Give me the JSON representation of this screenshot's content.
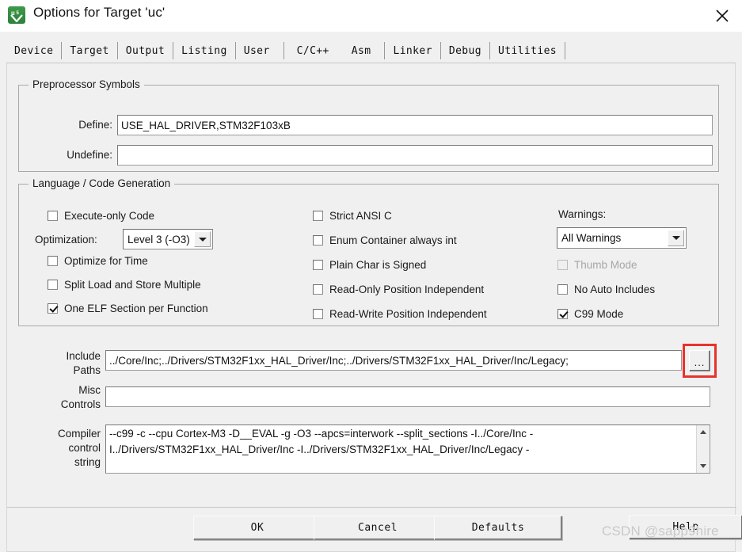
{
  "window": {
    "title": "Options for Target 'uc'",
    "icon": "keil-uvision5-icon",
    "close_label": "✕"
  },
  "tabs": [
    {
      "label": "Device",
      "active": false
    },
    {
      "label": "Target",
      "active": false
    },
    {
      "label": "Output",
      "active": false
    },
    {
      "label": "Listing",
      "active": false
    },
    {
      "label": "User",
      "active": false
    },
    {
      "label": "C/C++",
      "active": true
    },
    {
      "label": "Asm",
      "active": false
    },
    {
      "label": "Linker",
      "active": false
    },
    {
      "label": "Debug",
      "active": false
    },
    {
      "label": "Utilities",
      "active": false
    }
  ],
  "preprocessor": {
    "group_title": "Preprocessor Symbols",
    "define_label": "Define:",
    "define_value": "USE_HAL_DRIVER,STM32F103xB",
    "undefine_label": "Undefine:",
    "undefine_value": ""
  },
  "language": {
    "group_title": "Language / Code Generation",
    "execute_only_code": {
      "label": "Execute-only Code",
      "checked": false,
      "disabled": false
    },
    "optimization_label": "Optimization:",
    "optimization_value": "Level 3 (-O3)",
    "optimize_for_time": {
      "label": "Optimize for Time",
      "checked": false,
      "disabled": false
    },
    "split_load_store": {
      "label": "Split Load and Store Multiple",
      "checked": false,
      "disabled": false
    },
    "one_elf_section": {
      "label": "One ELF Section per Function",
      "checked": true,
      "disabled": false
    },
    "strict_ansi_c": {
      "label": "Strict ANSI C",
      "checked": false,
      "disabled": false
    },
    "enum_container_int": {
      "label": "Enum Container always int",
      "checked": false,
      "disabled": false
    },
    "plain_char_signed": {
      "label": "Plain Char is Signed",
      "checked": false,
      "disabled": false
    },
    "read_only_pos_ind": {
      "label": "Read-Only Position Independent",
      "checked": false,
      "disabled": false
    },
    "read_write_pos_ind": {
      "label": "Read-Write Position Independent",
      "checked": false,
      "disabled": false
    },
    "warnings_label": "Warnings:",
    "warnings_value": "All Warnings",
    "thumb_mode": {
      "label": "Thumb Mode",
      "checked": false,
      "disabled": true
    },
    "no_auto_includes": {
      "label": "No Auto Includes",
      "checked": false,
      "disabled": false
    },
    "c99_mode": {
      "label": "C99 Mode",
      "checked": true,
      "disabled": false
    }
  },
  "paths": {
    "include_label_line1": "Include",
    "include_label_line2": "Paths",
    "include_value": "../Core/Inc;../Drivers/STM32F1xx_HAL_Driver/Inc;../Drivers/STM32F1xx_HAL_Driver/Inc/Legacy;",
    "browse_label": "...",
    "misc_label_line1": "Misc",
    "misc_label_line2": "Controls",
    "misc_value": ""
  },
  "compiler": {
    "label_line1": "Compiler",
    "label_line2": "control",
    "label_line3": "string",
    "lines": [
      "--c99 -c --cpu Cortex-M3 -D__EVAL -g -O3 --apcs=interwork --split_sections -I../Core/Inc -",
      "I../Drivers/STM32F1xx_HAL_Driver/Inc -I../Drivers/STM32F1xx_HAL_Driver/Inc/Legacy -"
    ],
    "scroll_up": "▲",
    "scroll_down": "▼"
  },
  "footer": {
    "ok": "OK",
    "cancel": "Cancel",
    "defaults": "Defaults",
    "help": "Help"
  },
  "watermark": "CSDN @sapp9hire",
  "colors": {
    "dialog_bg": "#f0f0f0",
    "accent_highlight": "#e8322b",
    "text": "#1a1a1a",
    "field_bg": "#ffffff",
    "disabled_text": "#a6a6a6"
  }
}
